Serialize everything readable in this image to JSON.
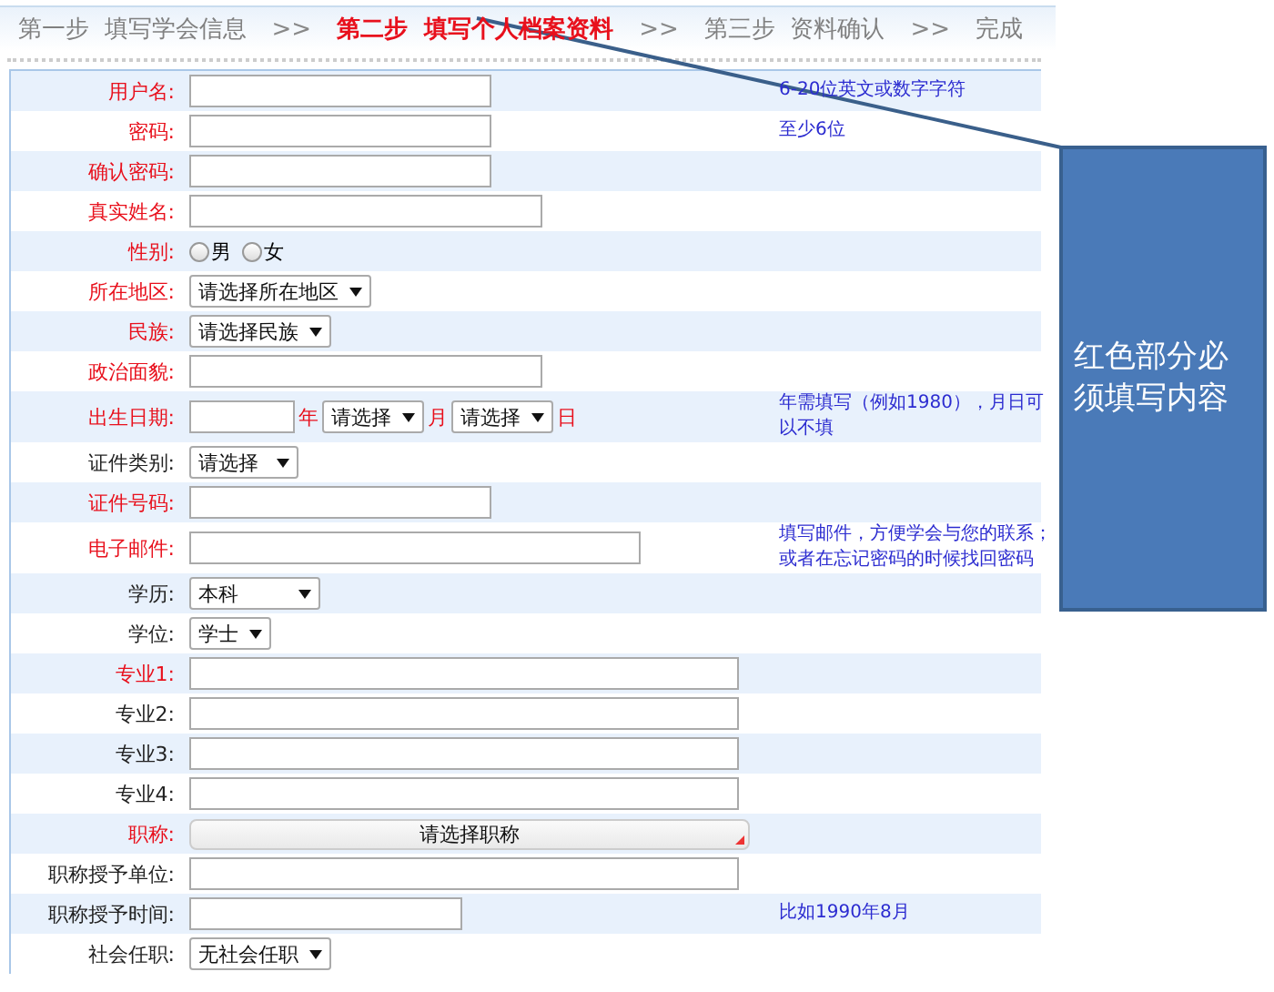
{
  "steps": [
    {
      "label": "第一步  填写学会信息",
      "selected": false
    },
    {
      "label": "第二步  填写个人档案资料",
      "selected": true
    },
    {
      "label": "第三步  资料确认",
      "selected": false
    },
    {
      "label": "完成",
      "selected": false
    }
  ],
  "step_separator": ">>",
  "rows": [
    {
      "label": "用户名:",
      "required": true,
      "kind": "text",
      "hint": "6-20位英文或数字字符"
    },
    {
      "label": "密码:",
      "required": true,
      "kind": "text",
      "hint": "至少6位"
    },
    {
      "label": "确认密码:",
      "required": true,
      "kind": "text"
    },
    {
      "label": "真实姓名:",
      "required": true,
      "kind": "widetext"
    },
    {
      "label": "性别:",
      "required": true,
      "kind": "radio",
      "options": [
        {
          "label": "男",
          "selected": false
        },
        {
          "label": "女",
          "selected": false
        }
      ]
    },
    {
      "label": "所在地区:",
      "required": true,
      "kind": "select",
      "value": "请选择所在地区"
    },
    {
      "label": "民族:",
      "required": true,
      "kind": "select",
      "value": "请选择民族"
    },
    {
      "label": "政治面貌:",
      "required": true,
      "kind": "widetext"
    },
    {
      "label": "出生日期:",
      "required": true,
      "kind": "date",
      "parts": [
        {
          "kind": "input"
        },
        {
          "kind": "unit",
          "text": "年"
        },
        {
          "kind": "select",
          "value": "请选择"
        },
        {
          "kind": "unit",
          "text": "月"
        },
        {
          "kind": "select",
          "value": "请选择"
        },
        {
          "kind": "unit",
          "text": "日"
        }
      ],
      "hint": "年需填写（例如1980），月日可以不填"
    },
    {
      "label": "证件类别:",
      "required": false,
      "kind": "padselect",
      "value": "请选择"
    },
    {
      "label": "证件号码:",
      "required": true,
      "kind": "text"
    },
    {
      "label": "电子邮件:",
      "required": true,
      "kind": "emailtext",
      "hint": "填写邮件，方便学会与您的联系；或者在忘记密码的时候找回密码"
    },
    {
      "label": "学历:",
      "required": false,
      "kind": "wideselect",
      "value": "本科"
    },
    {
      "label": "学位:",
      "required": false,
      "kind": "select",
      "value": "学士"
    },
    {
      "label": "专业1:",
      "required": true,
      "kind": "fulltext"
    },
    {
      "label": "专业2:",
      "required": false,
      "kind": "fulltext"
    },
    {
      "label": "专业3:",
      "required": false,
      "kind": "fulltext"
    },
    {
      "label": "专业4:",
      "required": false,
      "kind": "fulltext"
    },
    {
      "label": "职称:",
      "required": true,
      "kind": "button",
      "value": "请选择职称"
    },
    {
      "label": "职称授予单位:",
      "required": false,
      "kind": "fulltext"
    },
    {
      "label": "职称授予时间:",
      "required": false,
      "kind": "longtext",
      "hint": "比如1990年8月"
    },
    {
      "label": "社会任职:",
      "required": false,
      "kind": "select",
      "value": "无社会任职"
    }
  ],
  "callout": {
    "text": "红色部分必须填写内容"
  }
}
